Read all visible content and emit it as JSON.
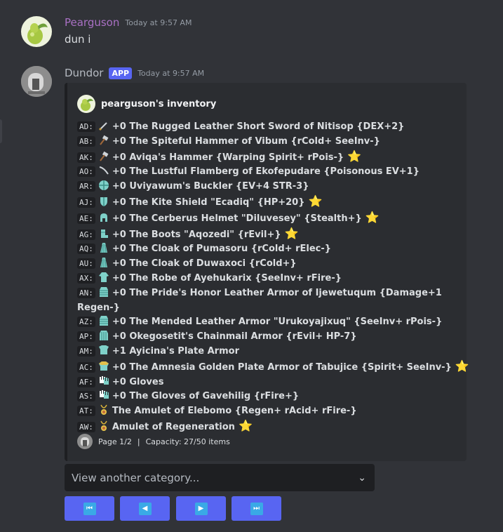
{
  "messages": [
    {
      "username": "Pearguson",
      "username_color": "#a970c4",
      "timestamp": "Today at 9:57 AM",
      "text": "dun i"
    },
    {
      "username": "Dundor",
      "username_color": "#b5bac1",
      "badge": "APP",
      "timestamp": "Today at 9:57 AM"
    }
  ],
  "embed": {
    "author": "pearguson's inventory",
    "items": [
      {
        "code": "AD:",
        "icon": "short-sword-icon",
        "text": "+0 The Rugged Leather Short Sword of Nitisop {DEX+2}",
        "star": false
      },
      {
        "code": "AB:",
        "icon": "hammer-icon",
        "text": "+0 The Spiteful Hammer of Vibum {rCold+ SeeInv-}",
        "star": false
      },
      {
        "code": "AK:",
        "icon": "hammer-icon",
        "text": "+0 Aviqa's Hammer {Warping Spirit+ rPois-}",
        "star": true
      },
      {
        "code": "AO:",
        "icon": "flamberg-icon",
        "text": "+0 The Lustful Flamberg of Ekofepudare {Poisonous EV+1}",
        "star": false
      },
      {
        "code": "AR:",
        "icon": "buckler-icon",
        "text": "+0 Uviyawum's Buckler {EV+4 STR-3}",
        "star": false
      },
      {
        "code": "AJ:",
        "icon": "kite-shield-icon",
        "text": "+0 The Kite Shield \"Ecadiq\" {HP+20}",
        "star": true
      },
      {
        "code": "AE:",
        "icon": "helmet-icon",
        "text": "+0 The Cerberus Helmet \"Diluvesey\" {Stealth+}",
        "star": true
      },
      {
        "code": "AG:",
        "icon": "boots-icon",
        "text": "+0 The Boots \"Aqozedi\" {rEvil+}",
        "star": true
      },
      {
        "code": "AQ:",
        "icon": "cloak-icon",
        "text": "+0 The Cloak of Pumasoru {rCold+ rElec-}",
        "star": false
      },
      {
        "code": "AU:",
        "icon": "cloak-icon",
        "text": "+0 The Cloak of Duwaxoci {rCold+}",
        "star": false
      },
      {
        "code": "AX:",
        "icon": "robe-icon",
        "text": "+0 The Robe of Ayehukarix {SeeInv+ rFire-}",
        "star": false
      },
      {
        "code": "AN:",
        "icon": "leather-armor-icon",
        "text": "+0 The Pride's Honor Leather Armor of Ijewetuqum {Damage+1 Regen-}",
        "star": false,
        "wrap": true
      },
      {
        "code": "AZ:",
        "icon": "leather-armor-icon",
        "text": "+0 The Mended Leather Armor \"Urukoyajixuq\" {SeeInv+ rPois-}",
        "star": false
      },
      {
        "code": "AP:",
        "icon": "chainmail-icon",
        "text": "+0 Okegosetit's Chainmail Armor {rEvil+ HP-7}",
        "star": false
      },
      {
        "code": "AM:",
        "icon": "plate-armor-icon",
        "text": "+1 Ayicina's Plate Armor",
        "star": false
      },
      {
        "code": "AC:",
        "icon": "golden-plate-armor-icon",
        "text": "+0 The Amnesia Golden Plate Armor of Tabujice {Spirit+ SeeInv-}",
        "star": true
      },
      {
        "code": "AF:",
        "icon": "gloves-icon",
        "text": "+0 Gloves",
        "star": false
      },
      {
        "code": "AS:",
        "icon": "gloves-icon",
        "text": "+0 The Gloves of Gavehilig {rFire+}",
        "star": false
      },
      {
        "code": "AT:",
        "icon": "amulet-icon",
        "text": "The Amulet of Elebomo {Regen+ rAcid+ rFire-}",
        "star": false
      },
      {
        "code": "AW:",
        "icon": "amulet-icon",
        "text": "Amulet of Regeneration",
        "star": true
      }
    ],
    "footer": {
      "page": "Page 1/2",
      "separator": "|",
      "capacity": "Capacity: 27/50 items"
    }
  },
  "select": {
    "placeholder": "View another category..."
  },
  "buttons": [
    {
      "name": "first-page",
      "glyph": "⏮"
    },
    {
      "name": "previous-page",
      "glyph": "◀"
    },
    {
      "name": "next-page",
      "glyph": "▶"
    },
    {
      "name": "last-page",
      "glyph": "⏭"
    }
  ],
  "colors": {
    "background": "#313338",
    "embed_background": "#2b2d31",
    "blurple": "#5865f2",
    "star": "#f9b62c"
  }
}
